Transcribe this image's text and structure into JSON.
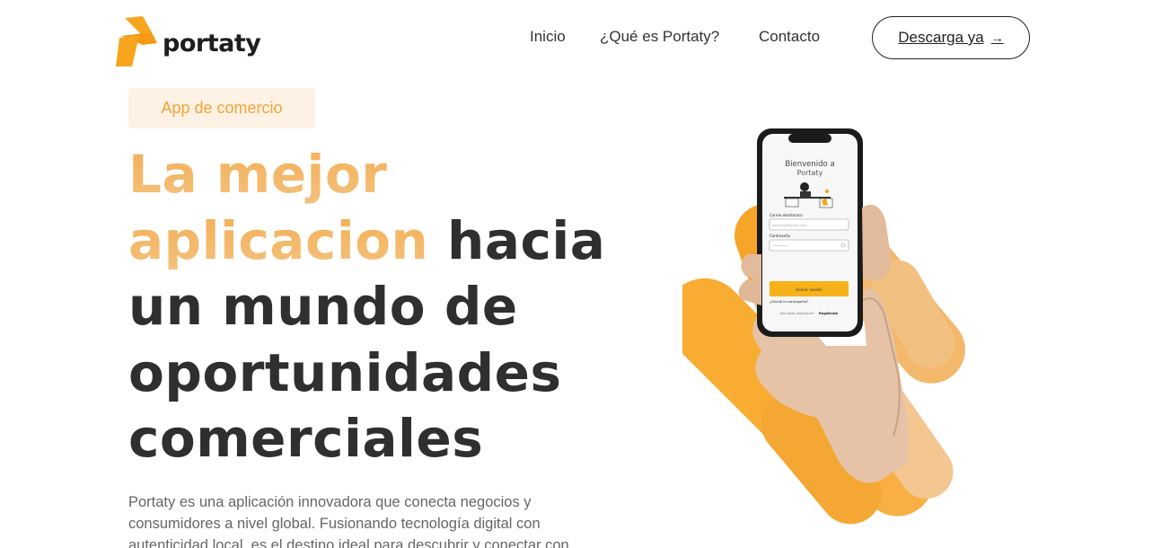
{
  "brand": {
    "name": "portaty",
    "logo_icon": "portaty-logo-icon"
  },
  "nav": {
    "items": [
      {
        "label": "Inicio"
      },
      {
        "label": "¿Qué es Portaty?"
      },
      {
        "label": "Contacto"
      }
    ],
    "cta_label": "Descarga ya",
    "cta_icon": "→"
  },
  "hero": {
    "badge": "App de comercio",
    "headline_highlight_1": "La mejor",
    "headline_highlight_2": "aplicacion",
    "headline_rest_1": "hacia",
    "headline_rest_2": "un mundo de",
    "headline_rest_3": "oportunidades",
    "headline_rest_4": "comerciales",
    "description": "Portaty es una aplicación innovadora que conecta negocios y consumidores a nivel global. Fusionando tecnología digital con autenticidad local, es el destino ideal para descubrir y conectar con"
  },
  "phone_screen": {
    "welcome_1": "Bienvenido a",
    "welcome_2": "Portaty",
    "email_label": "Correo electronico",
    "email_placeholder": "ejemplo@gmail.com",
    "password_label": "Contraseña",
    "password_placeholder": "••••••••",
    "login_button": "Iniciar sesión",
    "forgot": "¿Olvidó la contraseña?",
    "register_prompt": "¿No estás registrado?",
    "register_link": "Registrate"
  },
  "colors": {
    "accent": "#f4a43a",
    "badge_bg": "#fdf2e3",
    "text_dark": "#2f2f2f",
    "phone_button": "#f6b21b"
  }
}
